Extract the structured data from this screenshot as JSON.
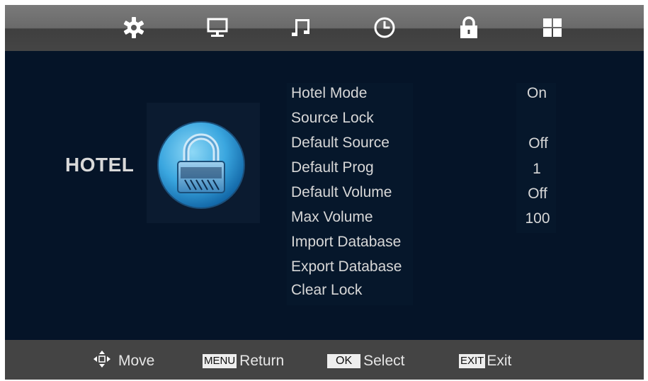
{
  "topbar": {
    "icons": [
      "settings-icon",
      "display-icon",
      "music-icon",
      "clock-icon",
      "lock-icon",
      "apps-icon"
    ],
    "active": "lock-icon"
  },
  "panel": {
    "title": "HOTEL",
    "icon": "padlock-icon"
  },
  "menu": {
    "items": [
      {
        "label": "Hotel Mode",
        "value": "On"
      },
      {
        "label": "Source Lock",
        "value": ""
      },
      {
        "label": "Default Source",
        "value": "Off"
      },
      {
        "label": "Default Prog",
        "value": "1"
      },
      {
        "label": "Default Volume",
        "value": "Off"
      },
      {
        "label": "Max Volume",
        "value": "100"
      },
      {
        "label": "Import Database",
        "value": ""
      },
      {
        "label": "Export Database",
        "value": ""
      },
      {
        "label": "Clear Lock",
        "value": ""
      }
    ]
  },
  "help": {
    "move": {
      "icon": "move-arrows-icon",
      "label": "Move"
    },
    "return": {
      "key": "MENU",
      "label": "Return"
    },
    "select": {
      "key": "OK",
      "label": "Select"
    },
    "exit": {
      "key": "EXIT",
      "label": "Exit"
    }
  },
  "colors": {
    "background": "#051428",
    "topbar": "#6a6a6a",
    "bottombar": "#444444",
    "text": "#d7d7d7"
  }
}
